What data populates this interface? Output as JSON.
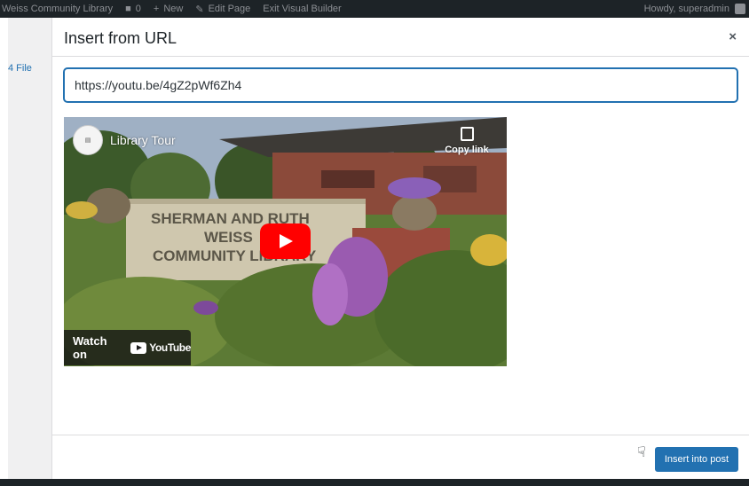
{
  "admin_bar": {
    "site_name": "Weiss Community Library",
    "comments_count": "0",
    "new_label": "New",
    "edit_page_label": "Edit Page",
    "exit_builder_label": "Exit Visual Builder",
    "howdy_label": "Howdy, superadmin"
  },
  "sidebar": {
    "file_link": "4 File"
  },
  "modal": {
    "title": "Insert from URL",
    "close_icon": "×",
    "url_value": "https://youtu.be/4gZ2pWf6Zh4",
    "insert_button": "Insert into post"
  },
  "video": {
    "title": "Library Tour",
    "copy_link": "Copy link",
    "watch_on": "Watch on",
    "youtube_brand": "YouTube",
    "sign_lines": [
      "SHERMAN AND RUTH",
      "WEISS",
      "COMMUNITY LIBRARY"
    ],
    "play_color": "#ff0000"
  },
  "colors": {
    "accent": "#2271b1",
    "admin_bar": "#1d2327"
  }
}
